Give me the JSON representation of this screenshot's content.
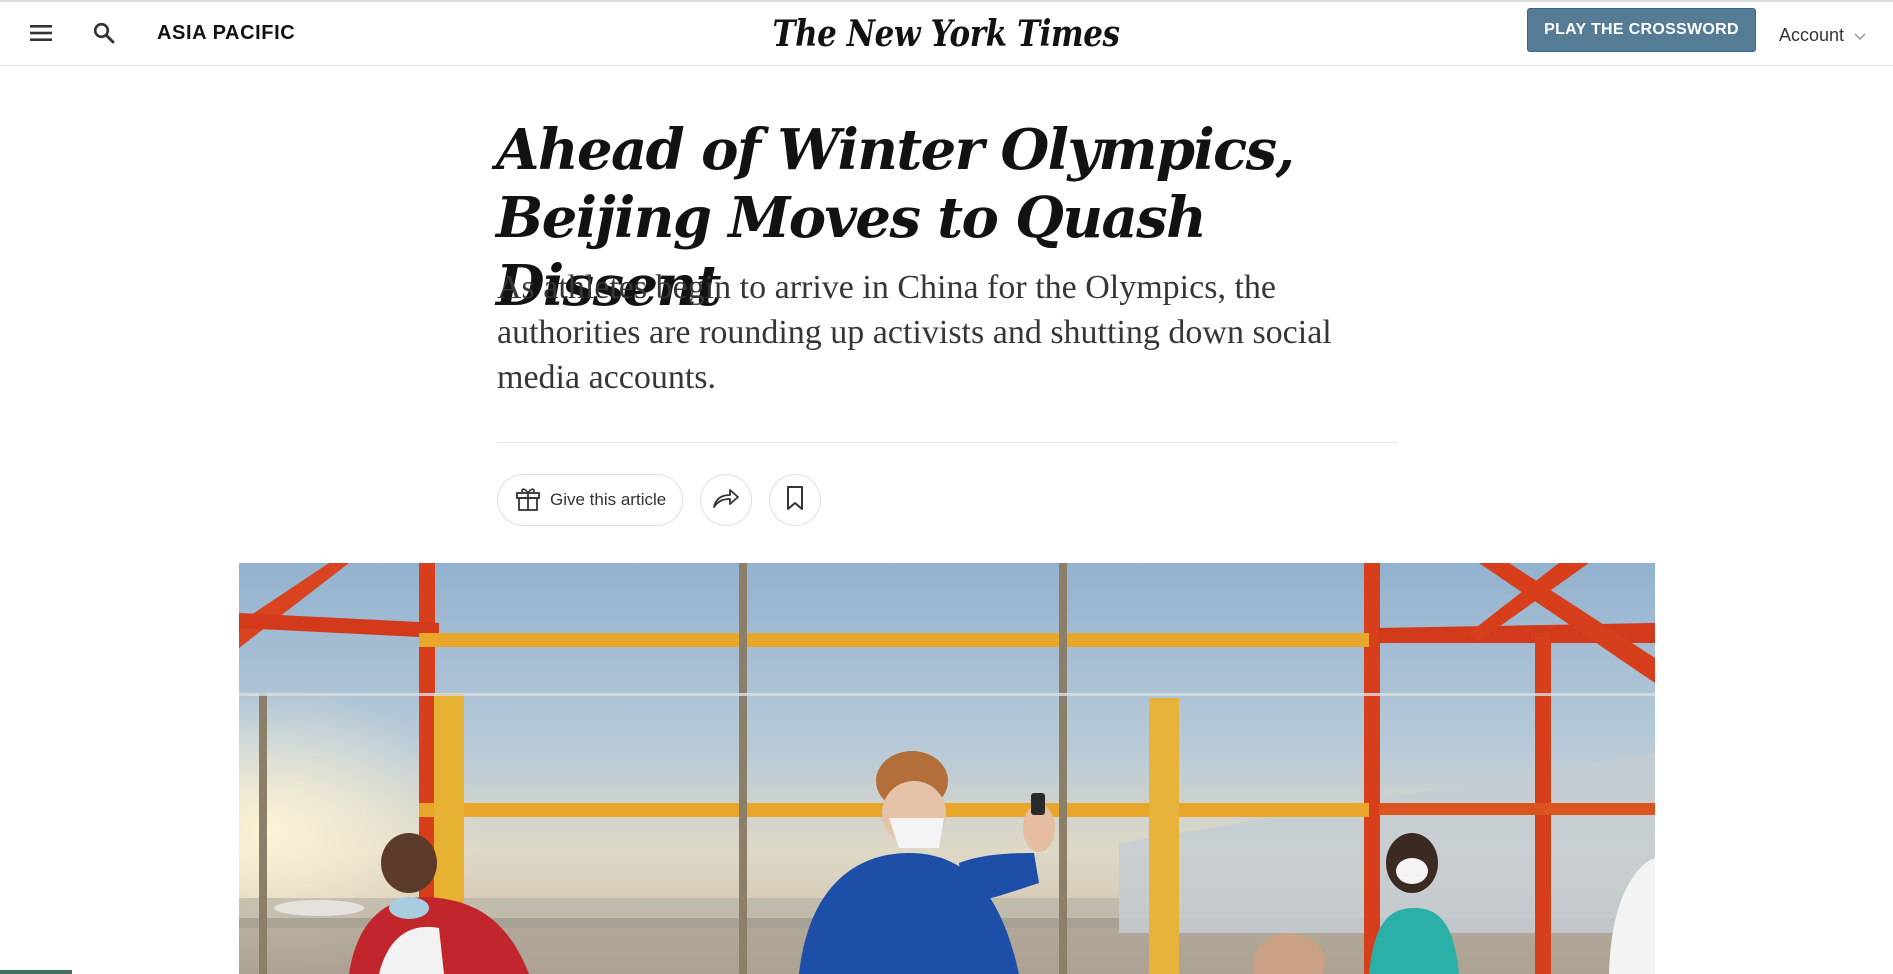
{
  "header": {
    "menu_icon": "hamburger-menu-icon",
    "search_icon": "search-icon",
    "section": "ASIA PACIFIC",
    "logo_text": "The New York Times",
    "cta_label": "PLAY THE CROSSWORD",
    "account_label": "Account",
    "account_icon": "chevron-down-icon"
  },
  "article": {
    "headline": "Ahead of Winter Olympics, Beijing Moves to Quash Dissent",
    "summary": "As athletes begin to arrive in China for the Olympics, the authorities are rounding up activists and shutting down social media accounts.",
    "gift_label": "Give this article",
    "gift_icon": "gift-icon",
    "share_icon": "share-arrow-icon",
    "save_icon": "bookmark-icon"
  },
  "colors": {
    "accent_button": "#567b95",
    "text": "#121212"
  }
}
